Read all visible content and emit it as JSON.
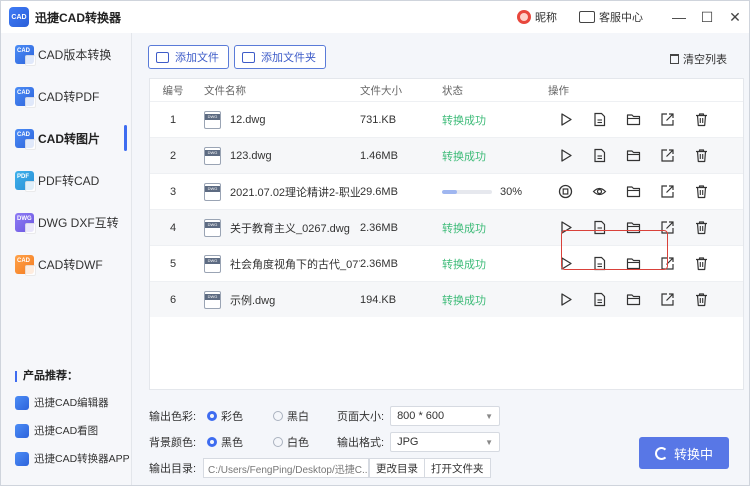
{
  "app": {
    "logo": "CAD",
    "title": "迅捷CAD转换器"
  },
  "titlebar": {
    "nickname": "昵称",
    "service": "客服中心",
    "minimize": "—",
    "restore": "☐",
    "close": "✕"
  },
  "sidebar": {
    "items": [
      {
        "label": "CAD版本转换",
        "icon": "cad-version-icon",
        "tag": "CAD"
      },
      {
        "label": "CAD转PDF",
        "icon": "cad-pdf-icon",
        "tag": "CAD"
      },
      {
        "label": "CAD转图片",
        "icon": "cad-image-icon",
        "tag": "CAD"
      },
      {
        "label": "PDF转CAD",
        "icon": "pdf-cad-icon",
        "tag": "PDF"
      },
      {
        "label": "DWG DXF互转",
        "icon": "dwg-dxf-icon",
        "tag": "DWG"
      },
      {
        "label": "CAD转DWF",
        "icon": "cad-dwf-icon",
        "tag": "CAD"
      }
    ],
    "active_index": 2,
    "products_title": "产品推荐：",
    "products": [
      "迅捷CAD编辑器",
      "迅捷CAD看图",
      "迅捷CAD转换器APP"
    ]
  },
  "toolbar": {
    "add_file": "添加文件",
    "add_folder": "添加文件夹",
    "clear_list": "清空列表"
  },
  "table": {
    "headers": {
      "no": "编号",
      "name": "文件名称",
      "size": "文件大小",
      "status": "状态",
      "ops": "操作"
    },
    "rows": [
      {
        "no": "1",
        "name": "12.dwg",
        "size": "731.KB",
        "status": "转换成功",
        "state": "done"
      },
      {
        "no": "2",
        "name": "123.dwg",
        "size": "1.46MB",
        "status": "转换成功",
        "state": "done"
      },
      {
        "no": "3",
        "name": "2021.07.02理论精讲2-职业...",
        "size": "29.6MB",
        "status": "30%",
        "state": "progress",
        "progress": 0.3
      },
      {
        "no": "4",
        "name": "关于教育主义_0267.dwg",
        "size": "2.36MB",
        "status": "转换成功",
        "state": "done"
      },
      {
        "no": "5",
        "name": "社会角度视角下的古代_0771...",
        "size": "2.36MB",
        "status": "转换成功",
        "state": "done"
      },
      {
        "no": "6",
        "name": "示例.dwg",
        "size": "194.KB",
        "status": "转换成功",
        "state": "done"
      }
    ],
    "file_icon_tag": "DWG"
  },
  "settings": {
    "color_label": "输出色彩:",
    "color_options": [
      "彩色",
      "黑白"
    ],
    "color_selected": 0,
    "page_size_label": "页面大小:",
    "page_size_value": "800 * 600",
    "bg_label": "背景颜色:",
    "bg_options": [
      "黑色",
      "白色"
    ],
    "bg_selected": 0,
    "format_label": "输出格式:",
    "format_value": "JPG",
    "dir_label": "输出目录:",
    "dir_value": "C:/Users/FengPing/Desktop/迅捷C...",
    "change_dir": "更改目录",
    "open_folder": "打开文件夹"
  },
  "convert_button": "转换中",
  "colors": {
    "accent": "#3e6cf0",
    "success": "#3dbb78",
    "highlight": "#d9413a",
    "convert": "#5877e6"
  }
}
